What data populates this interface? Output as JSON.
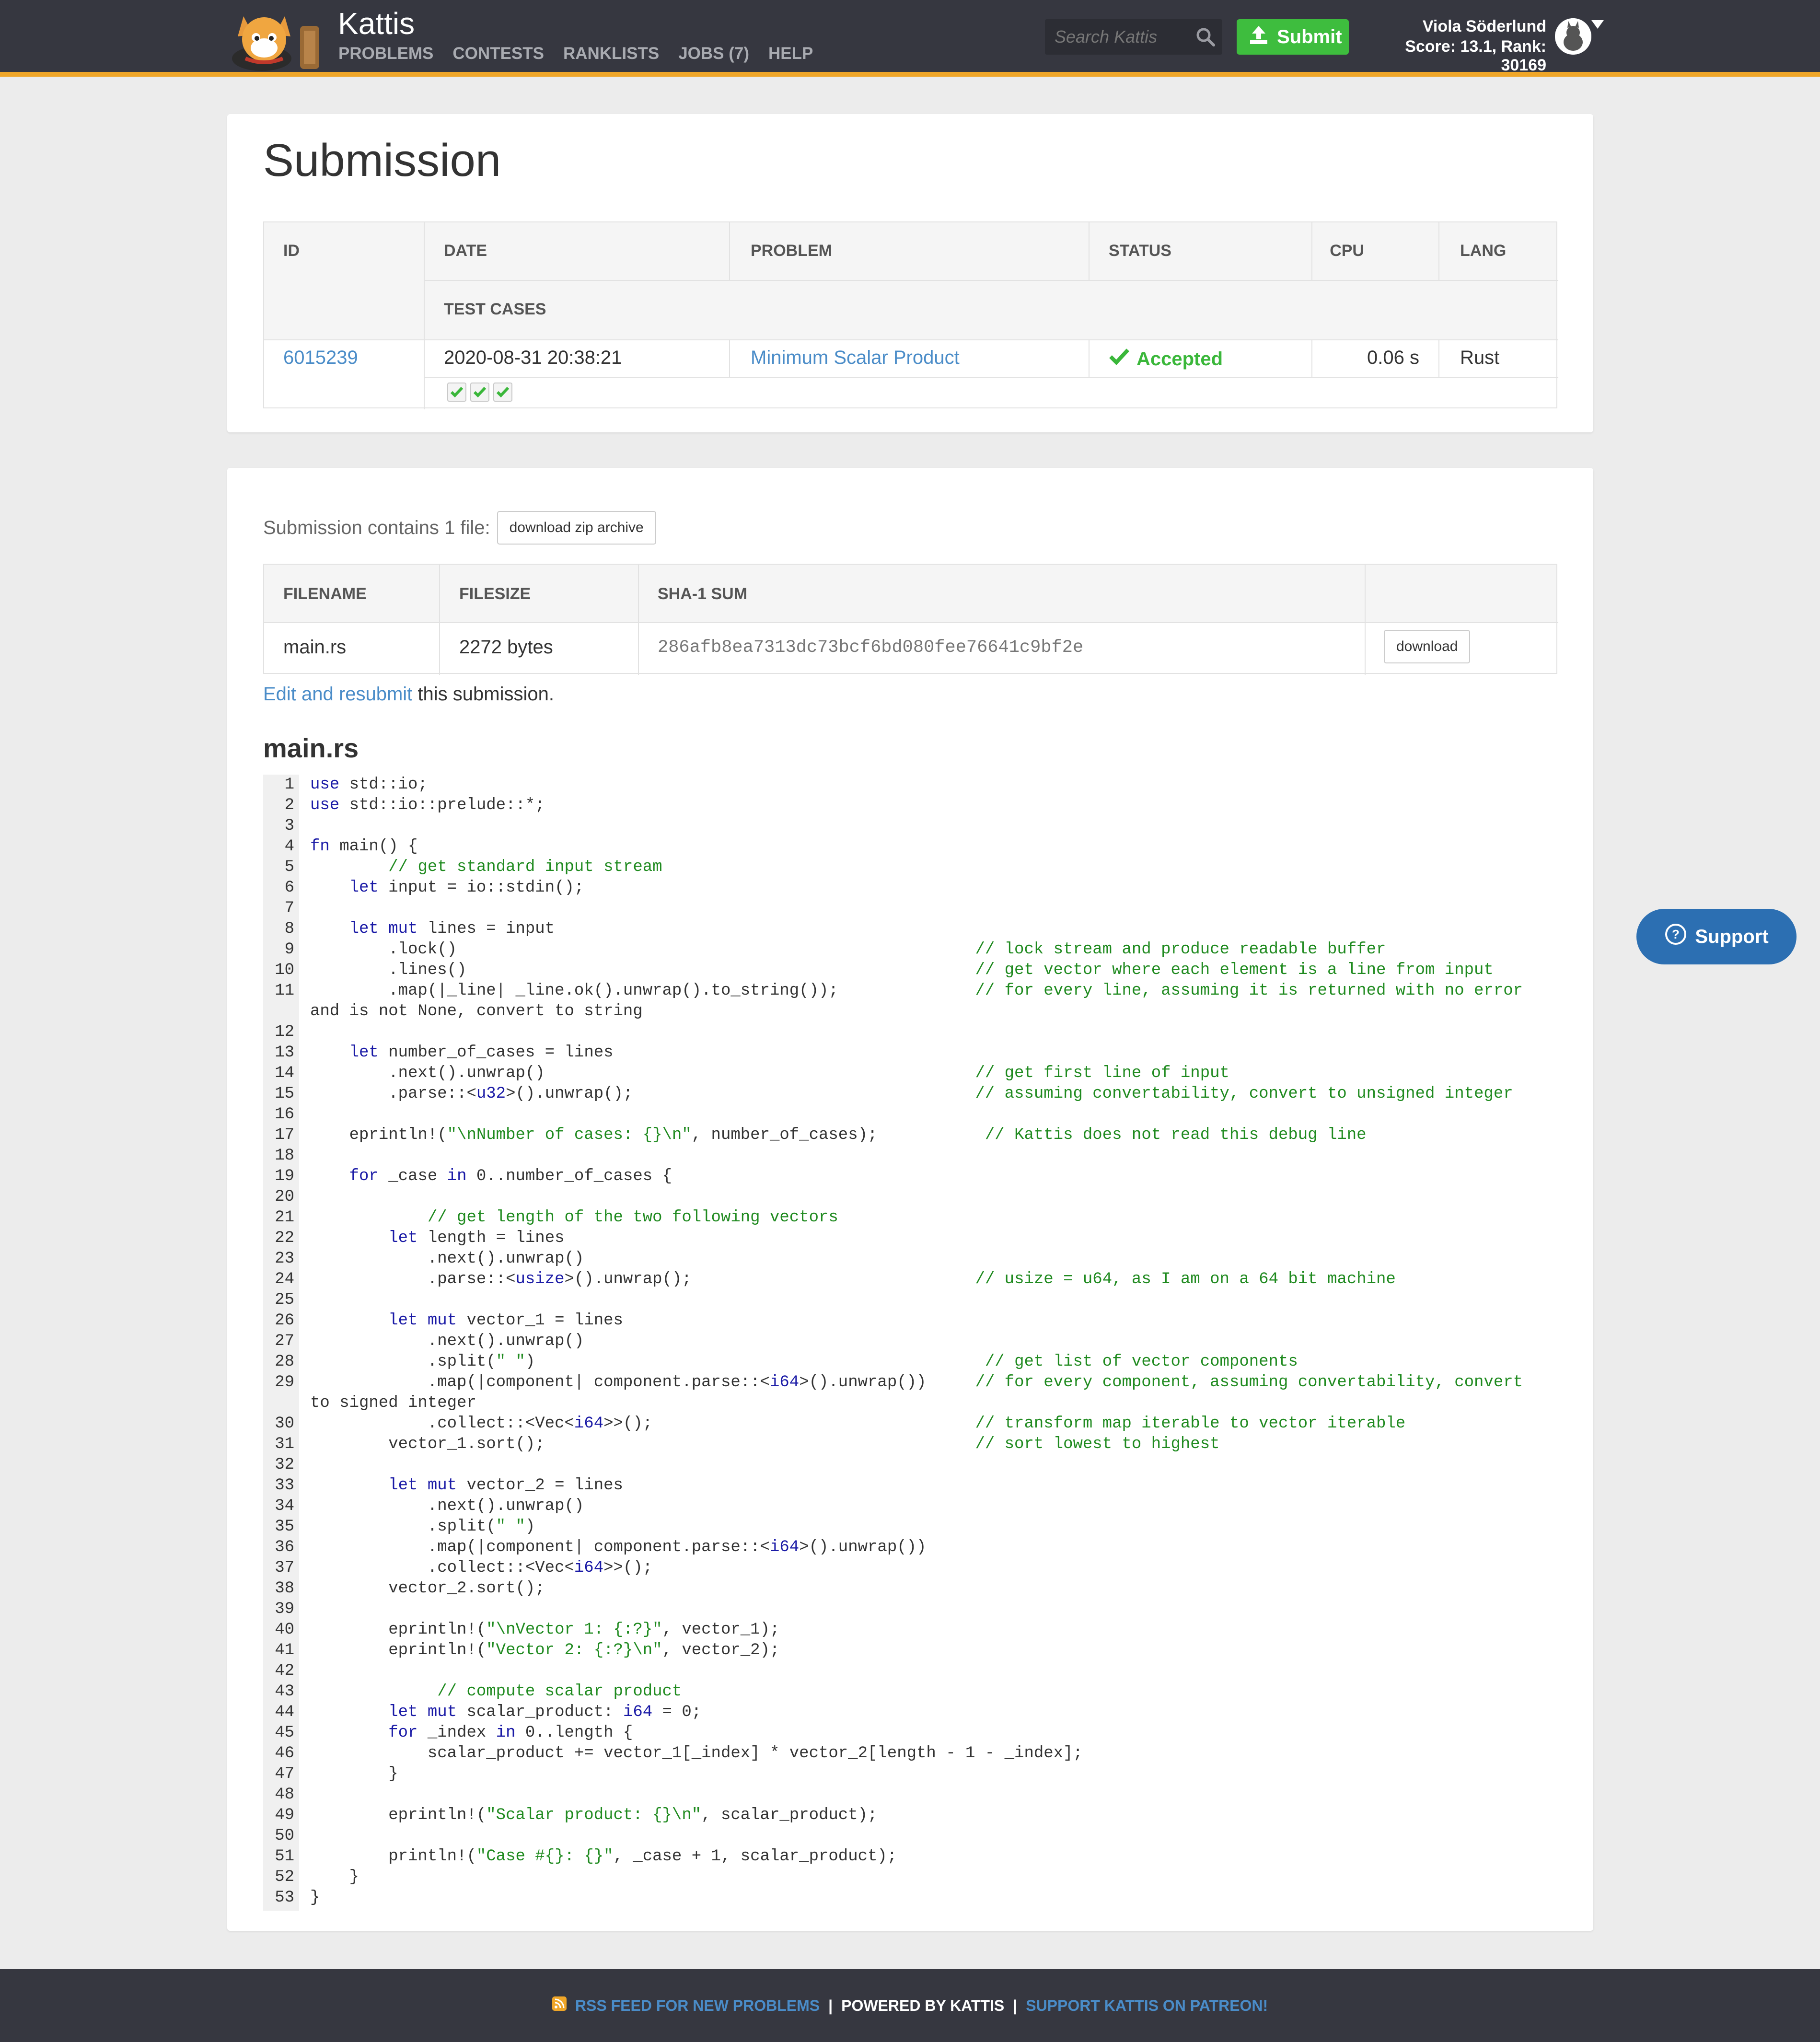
{
  "brand": {
    "name": "Kattis"
  },
  "nav": [
    {
      "label": "PROBLEMS"
    },
    {
      "label": "CONTESTS"
    },
    {
      "label": "RANKLISTS"
    },
    {
      "label": "JOBS (7)"
    },
    {
      "label": "HELP"
    }
  ],
  "search": {
    "placeholder": "Search Kattis"
  },
  "submit_label": "Submit",
  "user": {
    "name": "Viola Söderlund",
    "score_line": "Score: 13.1, Rank: 30169"
  },
  "page_title": "Submission",
  "submission_table": {
    "headers": {
      "id": "ID",
      "date": "DATE",
      "problem": "PROBLEM",
      "status": "STATUS",
      "cpu": "CPU",
      "lang": "LANG",
      "test_cases": "TEST CASES"
    },
    "row": {
      "id": "6015239",
      "date": "2020-08-31 20:38:21",
      "problem": "Minimum Scalar Product",
      "status": "Accepted",
      "cpu": "0.06 s",
      "lang": "Rust"
    },
    "test_cases": [
      "passed",
      "passed",
      "passed"
    ]
  },
  "files": {
    "intro": "Submission contains 1 file:",
    "zip_button": "download zip archive",
    "headers": {
      "filename": "FILENAME",
      "filesize": "FILESIZE",
      "sha": "SHA-1 SUM"
    },
    "row": {
      "filename": "main.rs",
      "filesize": "2272 bytes",
      "sha": "286afb8ea7313dc73bcf6bd080fee76641c9bf2e",
      "download": "download"
    }
  },
  "edit": {
    "link": "Edit and resubmit",
    "rest": " this submission."
  },
  "code_title": "main.rs",
  "code_lines": [
    {
      "n": "1",
      "t": "use std::io;"
    },
    {
      "n": "2",
      "t": "use std::io::prelude::*;"
    },
    {
      "n": "3",
      "t": ""
    },
    {
      "n": "4",
      "t": "fn main() {"
    },
    {
      "n": "5",
      "t": "        // get standard input stream"
    },
    {
      "n": "6",
      "t": "    let input = io::stdin();"
    },
    {
      "n": "7",
      "t": ""
    },
    {
      "n": "8",
      "t": "    let mut lines = input"
    },
    {
      "n": "9",
      "t": "        .lock()                                                     // lock stream and produce readable buffer"
    },
    {
      "n": "10",
      "t": "        .lines()                                                    // get vector where each element is a line from input"
    },
    {
      "n": "11",
      "t": "        .map(|_line| _line.ok().unwrap().to_string());              // for every line, assuming it is returned with no error"
    },
    {
      "n": "",
      "t": "and is not None, convert to string"
    },
    {
      "n": "12",
      "t": ""
    },
    {
      "n": "13",
      "t": "    let number_of_cases = lines"
    },
    {
      "n": "14",
      "t": "        .next().unwrap()                                            // get first line of input"
    },
    {
      "n": "15",
      "t": "        .parse::<u32>().unwrap();                                   // assuming convertability, convert to unsigned integer"
    },
    {
      "n": "16",
      "t": ""
    },
    {
      "n": "17",
      "t": "    eprintln!(\"\\nNumber of cases: {}\\n\", number_of_cases);           // Kattis does not read this debug line"
    },
    {
      "n": "18",
      "t": ""
    },
    {
      "n": "19",
      "t": "    for _case in 0..number_of_cases {"
    },
    {
      "n": "20",
      "t": ""
    },
    {
      "n": "21",
      "t": "            // get length of the two following vectors"
    },
    {
      "n": "22",
      "t": "        let length = lines"
    },
    {
      "n": "23",
      "t": "            .next().unwrap()"
    },
    {
      "n": "24",
      "t": "            .parse::<usize>().unwrap();                             // usize = u64, as I am on a 64 bit machine"
    },
    {
      "n": "25",
      "t": ""
    },
    {
      "n": "26",
      "t": "        let mut vector_1 = lines"
    },
    {
      "n": "27",
      "t": "            .next().unwrap()"
    },
    {
      "n": "28",
      "t": "            .split(\" \")                                              // get list of vector components"
    },
    {
      "n": "29",
      "t": "            .map(|component| component.parse::<i64>().unwrap())     // for every component, assuming convertability, convert"
    },
    {
      "n": "",
      "t": "to signed integer"
    },
    {
      "n": "30",
      "t": "            .collect::<Vec<i64>>();                                 // transform map iterable to vector iterable"
    },
    {
      "n": "31",
      "t": "        vector_1.sort();                                            // sort lowest to highest"
    },
    {
      "n": "32",
      "t": ""
    },
    {
      "n": "33",
      "t": "        let mut vector_2 = lines"
    },
    {
      "n": "34",
      "t": "            .next().unwrap()"
    },
    {
      "n": "35",
      "t": "            .split(\" \")"
    },
    {
      "n": "36",
      "t": "            .map(|component| component.parse::<i64>().unwrap())"
    },
    {
      "n": "37",
      "t": "            .collect::<Vec<i64>>();"
    },
    {
      "n": "38",
      "t": "        vector_2.sort();"
    },
    {
      "n": "39",
      "t": ""
    },
    {
      "n": "40",
      "t": "        eprintln!(\"\\nVector 1: {:?}\", vector_1);"
    },
    {
      "n": "41",
      "t": "        eprintln!(\"Vector 2: {:?}\\n\", vector_2);"
    },
    {
      "n": "42",
      "t": ""
    },
    {
      "n": "43",
      "t": "             // compute scalar product"
    },
    {
      "n": "44",
      "t": "        let mut scalar_product: i64 = 0;"
    },
    {
      "n": "45",
      "t": "        for _index in 0..length {"
    },
    {
      "n": "46",
      "t": "            scalar_product += vector_1[_index] * vector_2[length - 1 - _index];"
    },
    {
      "n": "47",
      "t": "        }"
    },
    {
      "n": "48",
      "t": ""
    },
    {
      "n": "49",
      "t": "        eprintln!(\"Scalar product: {}\\n\", scalar_product);"
    },
    {
      "n": "50",
      "t": ""
    },
    {
      "n": "51",
      "t": "        println!(\"Case #{}: {}\", _case + 1, scalar_product);"
    },
    {
      "n": "52",
      "t": "    }"
    },
    {
      "n": "53",
      "t": "}"
    }
  ],
  "support_label": "Support",
  "footer": {
    "rss": "RSS FEED FOR NEW PROBLEMS",
    "sep": "|",
    "powered": "POWERED BY KATTIS",
    "patreon": "SUPPORT KATTIS ON PATREON!"
  },
  "colors": {
    "accent": "#f0a628",
    "topbar": "#363740",
    "accepted": "#3ab73a",
    "link": "#4a8cc8",
    "submit": "#3ebd3e"
  }
}
